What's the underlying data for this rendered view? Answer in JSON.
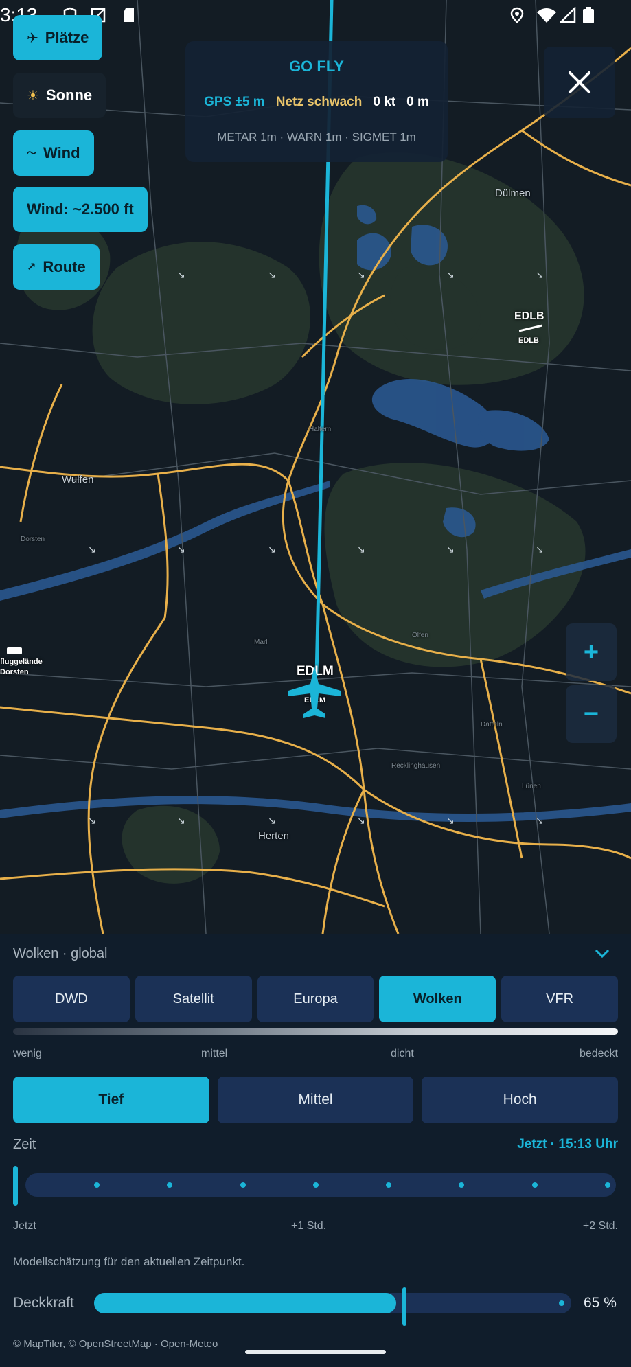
{
  "status_bar": {
    "time": "3:13",
    "icons": [
      "shield-icon",
      "screenshot-icon",
      "sdcard-icon",
      "location-icon",
      "wifi-icon",
      "signal-icon",
      "battery-icon"
    ]
  },
  "left_buttons": {
    "places": {
      "icon": "✈",
      "label": "Plätze"
    },
    "sun": {
      "icon": "☀",
      "label": "Sonne"
    },
    "wind": {
      "icon": "〜",
      "label": "Wind"
    },
    "wind_altitude": {
      "label": "Wind: ~2.500 ft"
    },
    "route": {
      "icon": "↗",
      "label": "Route"
    }
  },
  "gofly": {
    "title": "GO FLY",
    "gps": "GPS ±5 m",
    "network": "Netz schwach",
    "speed": "0 kt",
    "altitude": "0 m",
    "meta": "METAR 1m · WARN 1m · SIGMET 1m"
  },
  "map": {
    "towns": [
      "Dülmen",
      "Wulfen",
      "Herten",
      "Haltern",
      "Marl",
      "Dorsten",
      "Recklinghausen",
      "Datteln",
      "Lünen",
      "Olfen"
    ],
    "airfields": {
      "edlb": {
        "code": "EDLB",
        "sub": "EDLB"
      },
      "edlm": {
        "code": "EDLM",
        "sub": "EDLM"
      },
      "dorsten": {
        "line1": "fluggelände",
        "line2": "Dorsten"
      }
    },
    "zoom_in": "+",
    "zoom_out": "−"
  },
  "sheet": {
    "title": "Wolken · global",
    "tabs": [
      "DWD",
      "Satellit",
      "Europa",
      "Wolken",
      "VFR"
    ],
    "active_tab": "Wolken",
    "density_labels": [
      "wenig",
      "mittel",
      "dicht",
      "bedeckt"
    ],
    "layers": [
      "Tief",
      "Mittel",
      "Hoch"
    ],
    "active_layer": "Tief",
    "time_label": "Zeit",
    "time_now": "Jetzt · 15:13 Uhr",
    "time_labels": [
      "Jetzt",
      "+1 Std.",
      "+2 Std."
    ],
    "time_position": 0,
    "model_note": "Modellschätzung für den aktuellen Zeitpunkt.",
    "opacity_label": "Deckkraft",
    "opacity_value": "65 %",
    "opacity_fraction": 0.65
  },
  "attribution": "© MapTiler, © OpenStreetMap · Open-Meteo",
  "colors": {
    "accent": "#1bb5d8",
    "warning": "#e9c46a",
    "route": "#1bb5d8",
    "roads": "#e8b04a",
    "water": "#2b5a95",
    "forest": "#24332c"
  }
}
